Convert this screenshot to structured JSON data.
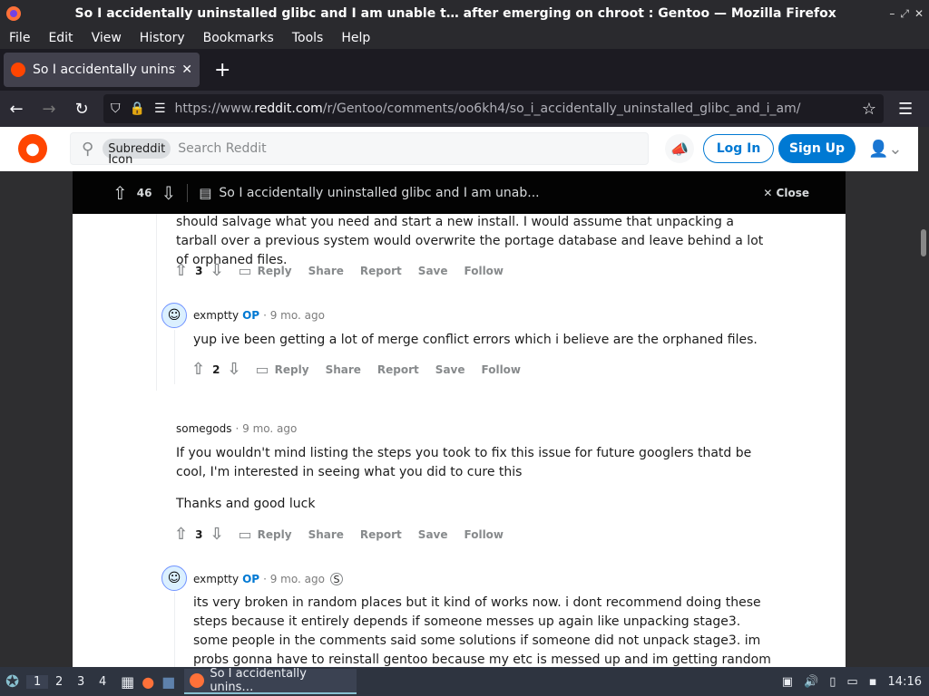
{
  "window": {
    "title": "So I accidentally uninstalled glibc and I am unable t… after emerging on chroot : Gentoo — Mozilla Firefox"
  },
  "menu": [
    "File",
    "Edit",
    "View",
    "History",
    "Bookmarks",
    "Tools",
    "Help"
  ],
  "tab": {
    "label": "So I accidentally uninsta"
  },
  "url": {
    "prefix": "https://www.",
    "domain": "reddit.com",
    "path": "/r/Gentoo/comments/oo6kh4/so_i_accidentally_uninstalled_glibc_and_i_am/"
  },
  "reddit_header": {
    "subreddit_chip": "Subreddit",
    "subreddit_icon_alt": "Icon",
    "search_placeholder": "Search Reddit",
    "login": "Log In",
    "signup": "Sign Up"
  },
  "post_bar": {
    "votes": "46",
    "title": "So I accidentally uninstalled glibc and I am unab...",
    "close": "Close"
  },
  "comments": [
    {
      "text": "should salvage what you need and start a new install. I would assume that unpacking a tarball over a previous system would overwrite the portage database and leave behind a lot of orphaned files.",
      "votes": "3",
      "actions": [
        "Reply",
        "Share",
        "Report",
        "Save",
        "Follow"
      ]
    },
    {
      "author": "exmptty",
      "op": "OP",
      "time": "9 mo. ago",
      "text": "yup ive been getting a lot of merge conflict errors which i believe are the orphaned files.",
      "votes": "2",
      "actions": [
        "Reply",
        "Share",
        "Report",
        "Save",
        "Follow"
      ]
    },
    {
      "author": "somegods",
      "time": "9 mo. ago",
      "text": "If you wouldn't mind listing the steps you took to fix this issue for future googlers thatd be cool, I'm interested in seeing what you did to cure this",
      "text2": "Thanks and good luck",
      "votes": "3",
      "actions": [
        "Reply",
        "Share",
        "Report",
        "Save",
        "Follow"
      ]
    },
    {
      "author": "exmptty",
      "op": "OP",
      "time": "9 mo. ago",
      "text": "its very broken in random places but it kind of works now. i dont recommend doing these steps because it entirely depends if someone messes up again like unpacking stage3. some people in the comments said some solutions if someone did not unpack stage3. im probs gonna have to reinstall gentoo because my etc is messed up and im getting random errors everywhere"
    }
  ],
  "taskbar": {
    "workspaces": [
      "1",
      "2",
      "3",
      "4"
    ],
    "task_label": "So I accidentally unins…",
    "clock": "14:16"
  }
}
